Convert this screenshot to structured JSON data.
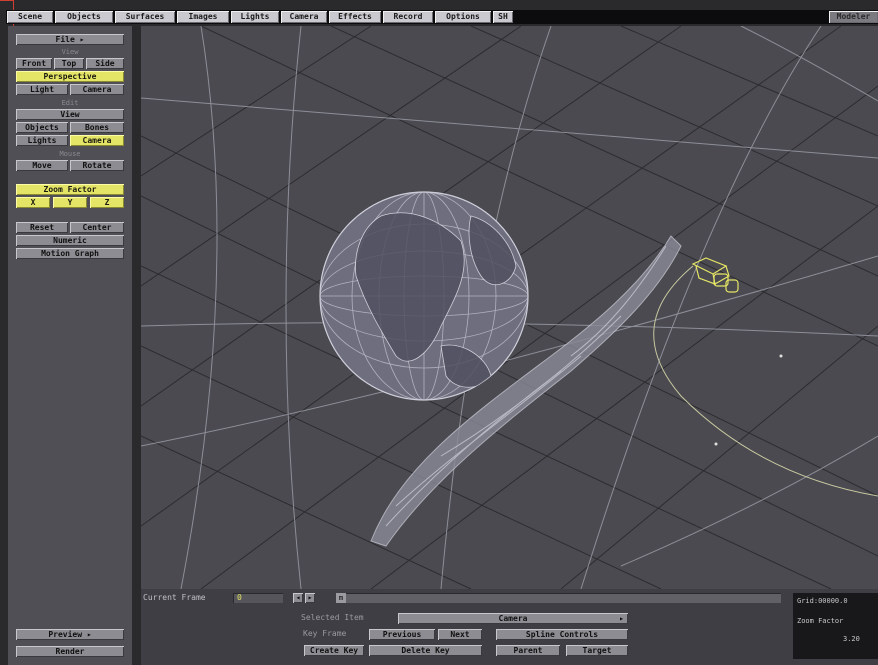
{
  "menu": {
    "tabs": [
      "Scene",
      "Objects",
      "Surfaces",
      "Images",
      "Lights",
      "Camera",
      "Effects",
      "Record",
      "Options",
      "SH"
    ],
    "modeler": "Modeler"
  },
  "sidebar": {
    "file": "File",
    "view_label": "View",
    "front": "Front",
    "top": "Top",
    "side": "Side",
    "perspective": "Perspective",
    "light": "Light",
    "camera": "Camera",
    "edit_label": "Edit",
    "edit_view": "View",
    "objects": "Objects",
    "bones": "Bones",
    "lights": "Lights",
    "edit_camera": "Camera",
    "mouse_label": "Mouse",
    "move": "Move",
    "rotate": "Rotate",
    "zoom_factor": "Zoom Factor",
    "x": "X",
    "y": "Y",
    "z": "Z",
    "reset": "Reset",
    "center": "Center",
    "numeric": "Numeric",
    "motion_graph": "Motion Graph",
    "preview": "Preview",
    "render": "Render"
  },
  "bottom": {
    "current_frame_label": "Current Frame",
    "current_frame_value": "0",
    "frame_marker": "m",
    "selected_item_label": "Selected Item",
    "selected_item_value": "Camera",
    "key_frame_label": "Key Frame",
    "previous": "Previous",
    "next": "Next",
    "spline_controls": "Spline Controls",
    "create_key": "Create Key",
    "delete_key": "Delete Key",
    "parent": "Parent",
    "target": "Target"
  },
  "info": {
    "grid": "Grid:00000.0",
    "zoom_factor": "Zoom Factor",
    "zoom_value": "3.20"
  },
  "colors": {
    "accent_yellow": "#e4e466",
    "button_gray": "#8c8c92",
    "panel": "#4f4f55",
    "viewport": "#4a4a50"
  }
}
